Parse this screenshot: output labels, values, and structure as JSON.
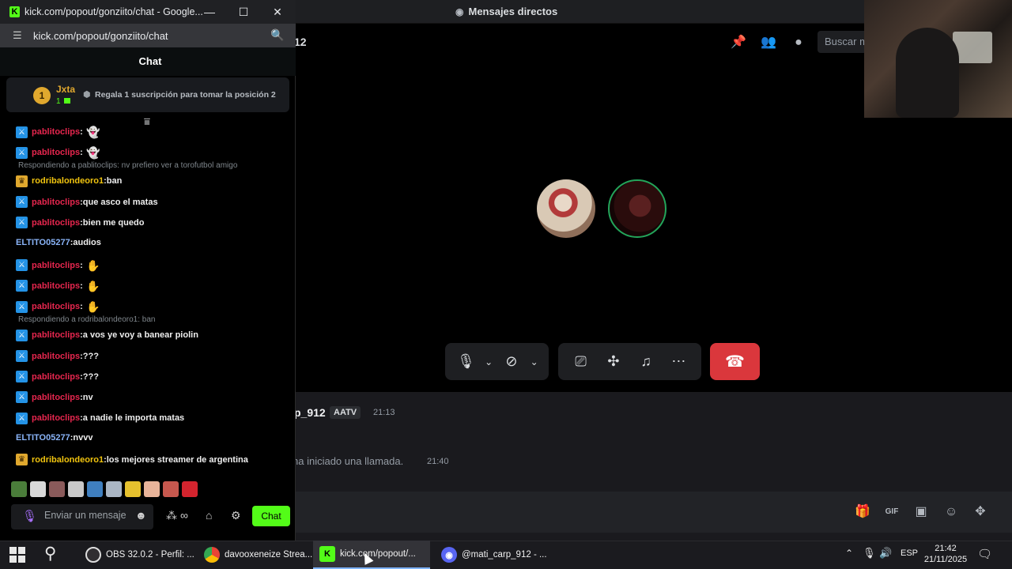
{
  "discord": {
    "title": "Mensajes directos",
    "channel_suffix": "12",
    "search_placeholder": "Buscar m",
    "message": {
      "author": "p_912",
      "tag": "AATV",
      "time": "21:13",
      "call_text": "ha iniciado una llamada.",
      "call_time": "21:40"
    },
    "icons": [
      "pin-icon",
      "add-user-icon",
      "profile-icon",
      "mic-icon",
      "video-off-icon",
      "screen-share-icon",
      "activity-icon",
      "soundboard-icon",
      "more-icon",
      "hangup-icon",
      "gift-icon",
      "gif-icon",
      "sticker-icon",
      "emoji-icon",
      "apps-icon"
    ],
    "colors": {
      "hangup": "#da373c",
      "speaking_ring": "#23a55a"
    }
  },
  "popup": {
    "window_title": "kick.com/popout/gonziito/chat - Google...",
    "url": "kick.com/popout/gonziito/chat",
    "chat_title": "Chat",
    "pinned": {
      "rank": "1",
      "user": "Jxta",
      "count": "1",
      "message": "Regala 1 suscripción para tomar la posición 2"
    },
    "messages": [
      {
        "kind": "msg",
        "badge": "mod",
        "user": "pablitoclips",
        "user_color": "pink",
        "text": "",
        "emote": "ghost"
      },
      {
        "kind": "msg",
        "badge": "mod",
        "user": "pablitoclips",
        "user_color": "pink",
        "text": "",
        "emote": "ghost"
      },
      {
        "kind": "reply",
        "text": "Respondiendo a pablitoclips: nv prefiero ver a torofutbol amigo"
      },
      {
        "kind": "msg",
        "badge": "crown",
        "user": "rodribalondeoro1",
        "user_color": "gold",
        "text": "ban"
      },
      {
        "kind": "msg",
        "badge": "mod",
        "user": "pablitoclips",
        "user_color": "pink",
        "text": "que asco el matas"
      },
      {
        "kind": "msg",
        "badge": "mod",
        "user": "pablitoclips",
        "user_color": "pink",
        "text": "bien me quedo"
      },
      {
        "kind": "msg",
        "badge": "",
        "user": "ELTITO05277",
        "user_color": "blue",
        "text": "audios"
      },
      {
        "kind": "msg",
        "badge": "mod",
        "user": "pablitoclips",
        "user_color": "pink",
        "text": "",
        "emote": "pink"
      },
      {
        "kind": "msg",
        "badge": "mod",
        "user": "pablitoclips",
        "user_color": "pink",
        "text": "",
        "emote": "pink"
      },
      {
        "kind": "msg",
        "badge": "mod",
        "user": "pablitoclips",
        "user_color": "pink",
        "text": "",
        "emote": "pink"
      },
      {
        "kind": "reply",
        "text": "Respondiendo a rodribalondeoro1: ban"
      },
      {
        "kind": "msg",
        "badge": "mod",
        "user": "pablitoclips",
        "user_color": "pink",
        "text": "a vos ye voy a banear piolin"
      },
      {
        "kind": "msg",
        "badge": "mod",
        "user": "pablitoclips",
        "user_color": "pink",
        "text": "???"
      },
      {
        "kind": "msg",
        "badge": "mod",
        "user": "pablitoclips",
        "user_color": "pink",
        "text": "???"
      },
      {
        "kind": "msg",
        "badge": "mod",
        "user": "pablitoclips",
        "user_color": "pink",
        "text": "nv"
      },
      {
        "kind": "msg",
        "badge": "mod",
        "user": "pablitoclips",
        "user_color": "pink",
        "text": "a nadie le importa matas"
      },
      {
        "kind": "msg",
        "badge": "",
        "user": "ELTITO05277",
        "user_color": "blue",
        "text": "nvvv"
      },
      {
        "kind": "msg",
        "badge": "crown",
        "user": "rodribalondeoro1",
        "user_color": "gold",
        "text": "los mejores streamer de argentina"
      }
    ],
    "input_placeholder": "Enviar un mensaje",
    "send_label": "Chat",
    "colors": {
      "kick_green": "#53fc18",
      "mod_user": "#e6264e",
      "vip_user": "#f1c40f",
      "user_blue": "#8ab4f8"
    }
  },
  "taskbar": {
    "apps": [
      {
        "label": "OBS 32.0.2 - Perfil: ...",
        "icon": "obs-icon",
        "active": false
      },
      {
        "label": "davooxeneize Strea...",
        "icon": "chrome-icon",
        "active": false
      },
      {
        "label": "kick.com/popout/...",
        "icon": "kick-icon",
        "active": true
      },
      {
        "label": "@mati_carp_912 - ...",
        "icon": "discord-icon",
        "active": false
      }
    ],
    "language": "ESP",
    "time": "21:42",
    "date": "21/11/2025"
  }
}
